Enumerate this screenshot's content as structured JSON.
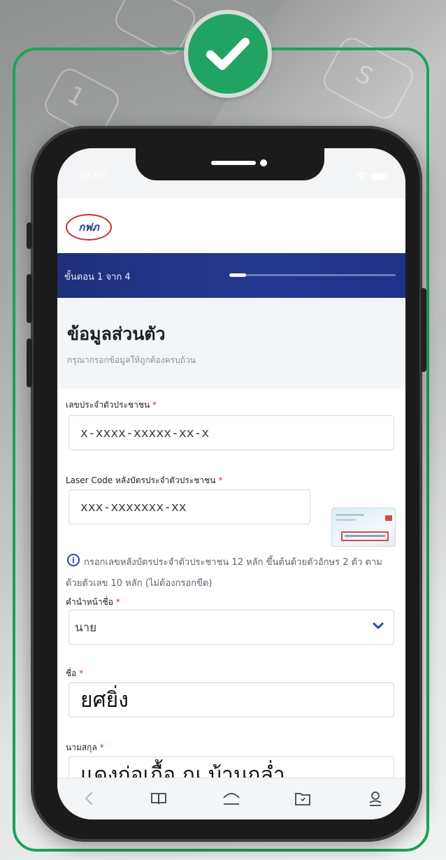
{
  "status_bar": {
    "time": "08:00"
  },
  "header": {
    "logo_text": "กฟภ"
  },
  "progress": {
    "label": "ขั้นตอน 1 จาก 4",
    "current_step": 1,
    "total_steps": 4,
    "fraction": 0.1
  },
  "section": {
    "title": "ข้อมูลส่วนตัว",
    "subtitle": "กรุณากรอกข้อมูลให้ถูกต้องครบถ้วน"
  },
  "fields": {
    "id_number": {
      "label": "เลขประจำตัวประชาชน",
      "required_mark": "*",
      "placeholder": "x-xxxx-xxxxx-xx-x"
    },
    "laser_code": {
      "label": "Laser Code หลังบัตรประจำตัวประชาชน",
      "required_mark": "*",
      "placeholder": "xxx-xxxxxxx-xx",
      "hint": "กรอกเลขหลังบัตรประจำตัวประชาชน 12 หลัก ขึ้นต้นด้วยตัวอักษร 2 ตัว ตามด้วยตัวเลข 10 หลัก (ไม่ต้องกรอกขีด)"
    },
    "title": {
      "label": "คำนำหน้าชื่อ",
      "required_mark": "*",
      "value": "นาย"
    },
    "first_name": {
      "label": "ชื่อ",
      "required_mark": "*",
      "value": "ยศยิ่ง"
    },
    "last_name": {
      "label": "นามสกุล",
      "required_mark": "*",
      "value": "แดงก่อเกื้อ ณ บ้านกล่ำ"
    }
  },
  "icons": {
    "badge": "check-icon",
    "hint": "info-icon",
    "select": "chevron-down-icon",
    "nav": [
      "back-icon",
      "book-icon",
      "cloud-icon",
      "folder-icon",
      "user-icon"
    ]
  },
  "colors": {
    "accent_green": "#21a463",
    "header_blue": "#1e2f7a",
    "hint_blue": "#2b4aa6",
    "required_red": "#d03030"
  }
}
